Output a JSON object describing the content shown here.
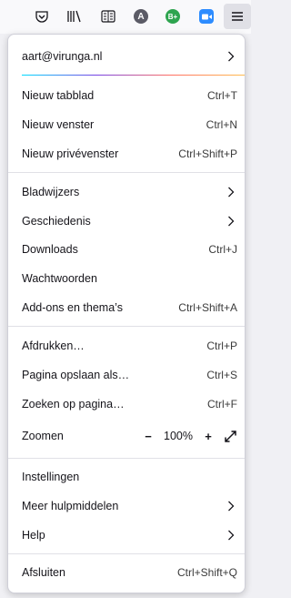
{
  "toolbar": {
    "icons": [
      "pocket-icon",
      "library-icon",
      "reader-view-icon",
      "extension-a-icon",
      "extension-b-plus-icon",
      "video-call-icon",
      "hamburger-menu-icon"
    ],
    "ext_a_letter": "A",
    "ext_b_letter": "B+",
    "colors": {
      "ext_a": "#5b5b66",
      "ext_b": "#2ea44f",
      "video": "#2d8cff"
    }
  },
  "account": {
    "email": "aart@virunga.nl"
  },
  "menu": {
    "new_tab": {
      "label": "Nieuw tabblad",
      "shortcut": "Ctrl+T"
    },
    "new_window": {
      "label": "Nieuw venster",
      "shortcut": "Ctrl+N"
    },
    "new_private": {
      "label": "Nieuw privévenster",
      "shortcut": "Ctrl+Shift+P"
    },
    "bookmarks": {
      "label": "Bladwijzers"
    },
    "history": {
      "label": "Geschiedenis"
    },
    "downloads": {
      "label": "Downloads",
      "shortcut": "Ctrl+J"
    },
    "passwords": {
      "label": "Wachtwoorden"
    },
    "addons": {
      "label": "Add-ons en thema’s",
      "shortcut": "Ctrl+Shift+A"
    },
    "print": {
      "label": "Afdrukken…",
      "shortcut": "Ctrl+P"
    },
    "save_page": {
      "label": "Pagina opslaan als…",
      "shortcut": "Ctrl+S"
    },
    "find": {
      "label": "Zoeken op pagina…",
      "shortcut": "Ctrl+F"
    },
    "zoom": {
      "label": "Zoomen",
      "minus": "−",
      "value": "100%",
      "plus": "+"
    },
    "settings": {
      "label": "Instellingen"
    },
    "more_tools": {
      "label": "Meer hulpmiddelen"
    },
    "help": {
      "label": "Help"
    },
    "quit": {
      "label": "Afsluiten",
      "shortcut": "Ctrl+Shift+Q"
    }
  }
}
